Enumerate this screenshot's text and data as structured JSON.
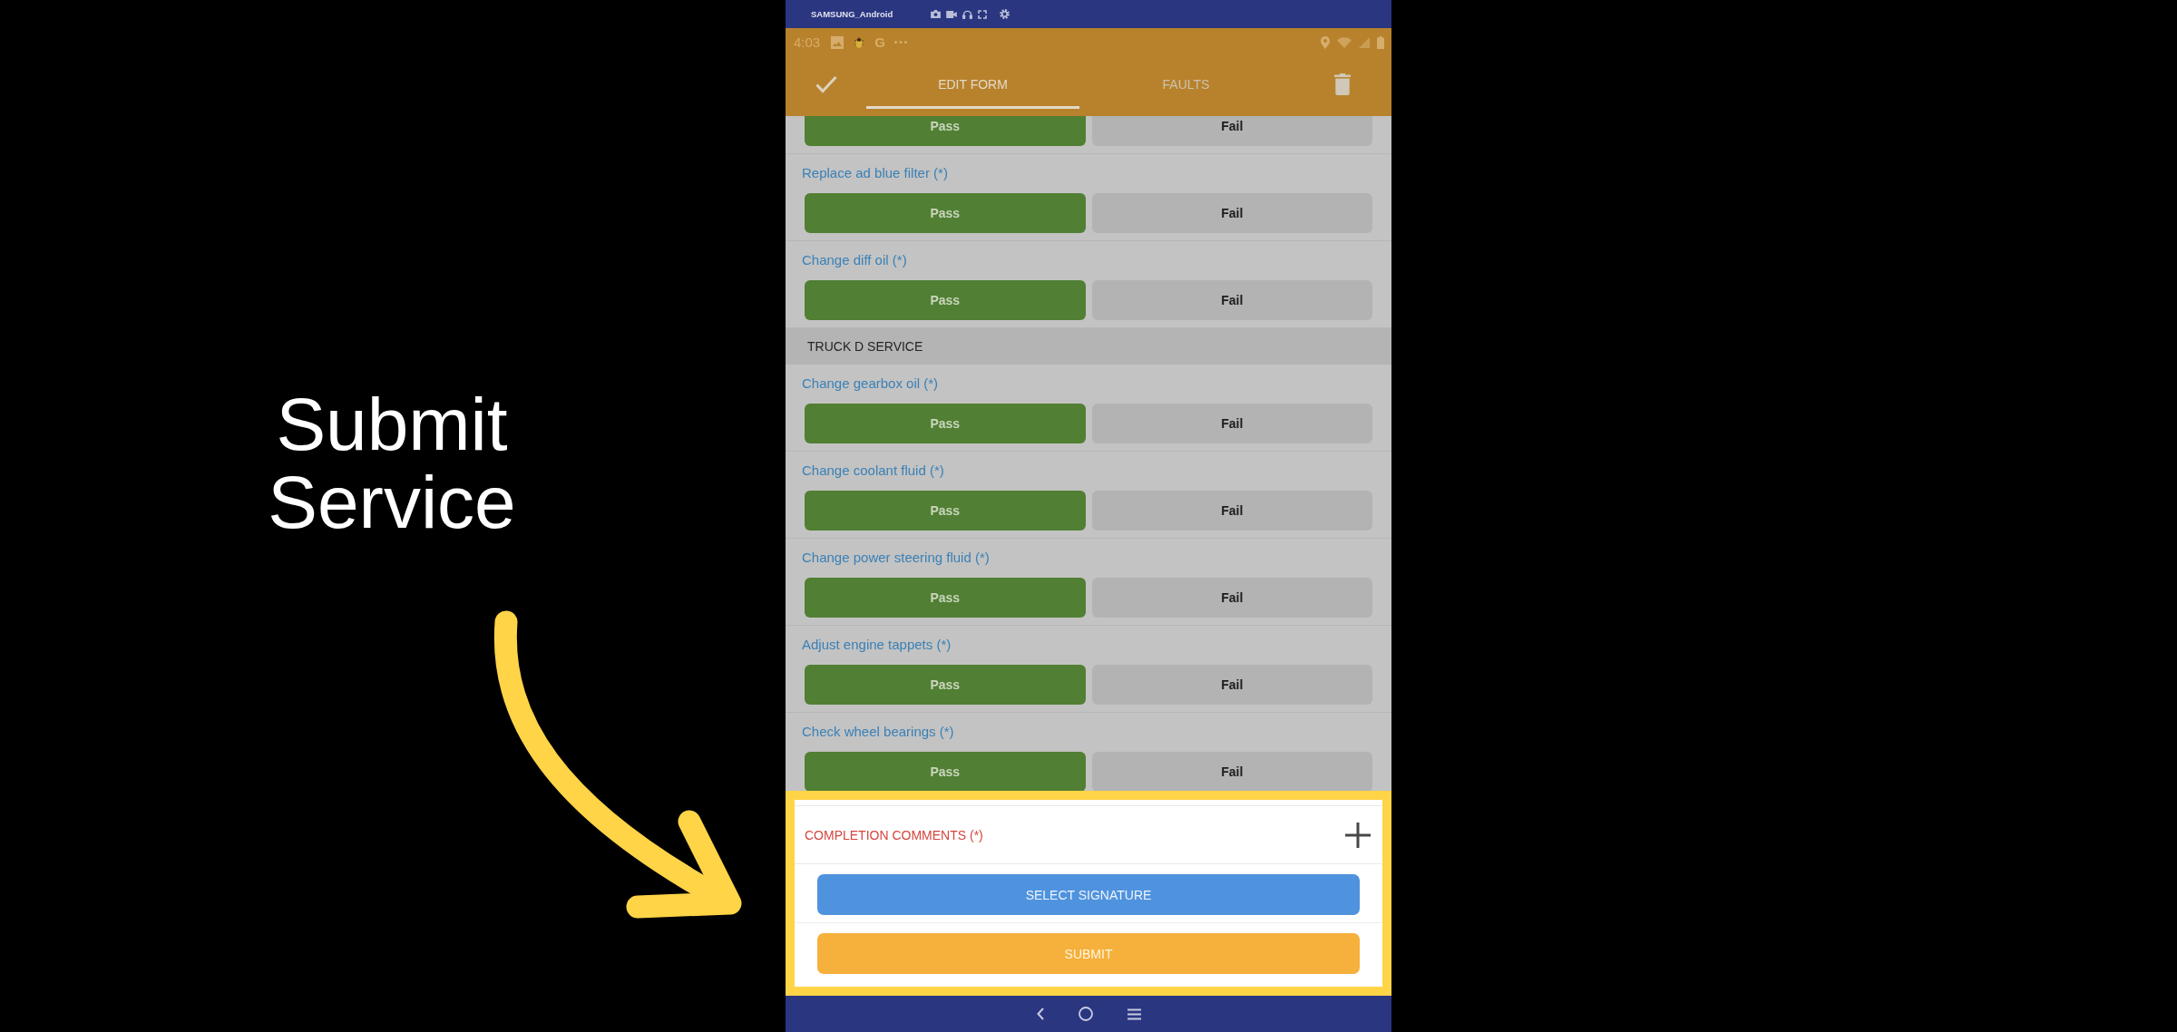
{
  "callout": {
    "text": "Submit Service"
  },
  "emulator_bar": {
    "title": "SAMSUNG_Android"
  },
  "status_bar": {
    "time": "4:03",
    "app_letter": "G"
  },
  "app_bar": {
    "tabs": [
      {
        "label": "EDIT FORM",
        "selected": true
      },
      {
        "label": "FAULTS",
        "selected": false
      }
    ]
  },
  "form": {
    "items": [
      {
        "kind": "check",
        "options": [
          {
            "label": "Pass",
            "selected": true
          },
          {
            "label": "Fail",
            "selected": false
          }
        ]
      },
      {
        "kind": "check",
        "label": "Replace ad blue filter (*)",
        "options": [
          {
            "label": "Pass",
            "selected": true
          },
          {
            "label": "Fail",
            "selected": false
          }
        ]
      },
      {
        "kind": "check",
        "label": "Change diff oil (*)",
        "options": [
          {
            "label": "Pass",
            "selected": true
          },
          {
            "label": "Fail",
            "selected": false
          }
        ]
      },
      {
        "kind": "section",
        "title": "TRUCK D SERVICE"
      },
      {
        "kind": "check",
        "label": "Change gearbox oil (*)",
        "options": [
          {
            "label": "Pass",
            "selected": true
          },
          {
            "label": "Fail",
            "selected": false
          }
        ]
      },
      {
        "kind": "check",
        "label": "Change coolant fluid (*)",
        "options": [
          {
            "label": "Pass",
            "selected": true
          },
          {
            "label": "Fail",
            "selected": false
          }
        ]
      },
      {
        "kind": "check",
        "label": "Change power steering fluid (*)",
        "options": [
          {
            "label": "Pass",
            "selected": true
          },
          {
            "label": "Fail",
            "selected": false
          }
        ]
      },
      {
        "kind": "check",
        "label": "Adjust engine tappets (*)",
        "options": [
          {
            "label": "Pass",
            "selected": true
          },
          {
            "label": "Fail",
            "selected": false
          }
        ]
      },
      {
        "kind": "check",
        "label": "Check wheel bearings (*)",
        "options": [
          {
            "label": "Pass",
            "selected": true
          },
          {
            "label": "Fail",
            "selected": false
          }
        ]
      }
    ]
  },
  "completion": {
    "highlighted": true,
    "label": "COMPLETION COMMENTS (*)",
    "buttons": [
      {
        "kind": "signature",
        "label": "SELECT SIGNATURE"
      },
      {
        "kind": "submit",
        "label": "SUBMIT"
      }
    ]
  }
}
